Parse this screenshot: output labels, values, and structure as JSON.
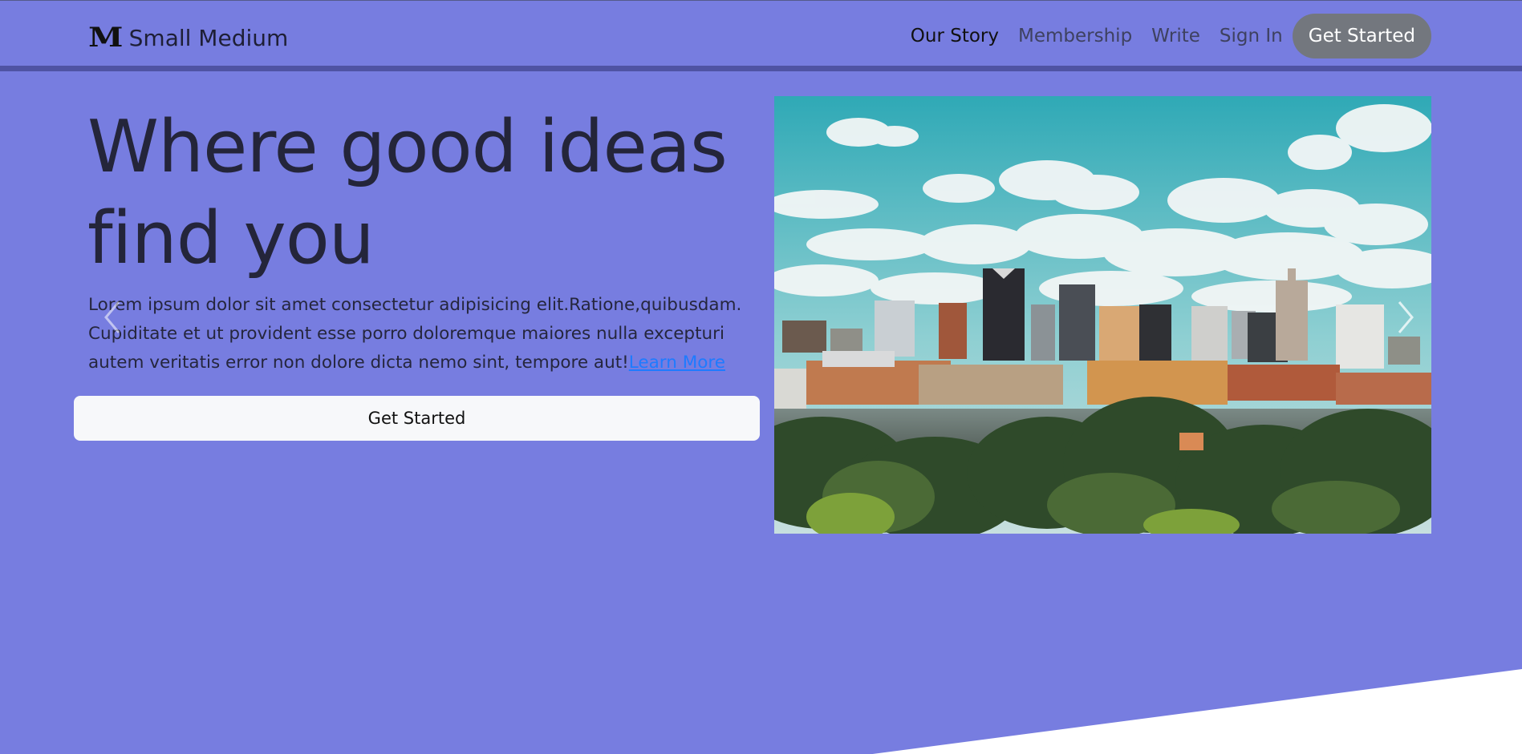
{
  "nav": {
    "brand_logo": "M",
    "brand_name": "Small Medium",
    "links": [
      {
        "label": "Our Story",
        "active": true
      },
      {
        "label": "Membership",
        "active": false
      },
      {
        "label": "Write",
        "active": false
      },
      {
        "label": "Sign In",
        "active": false
      }
    ],
    "cta_label": "Get Started"
  },
  "hero": {
    "title": "Where good ideas find you",
    "body": "Lorem ipsum dolor sit amet consectetur adipisicing elit.Ratione,quibusdam. Cupiditate et ut provident esse porro doloremque maiores nulla excepturi autem veritatis error non dolore dicta nemo sint, tempore aut!",
    "learn_more": "Learn More",
    "button_label": "Get Started"
  },
  "carousel": {
    "prev_icon": "chevron-left-icon",
    "next_icon": "chevron-right-icon"
  },
  "colors": {
    "background": "#777de0",
    "navbar_border": "#4f53a3",
    "cta_bg": "#73777e",
    "link": "#1e7bff"
  }
}
